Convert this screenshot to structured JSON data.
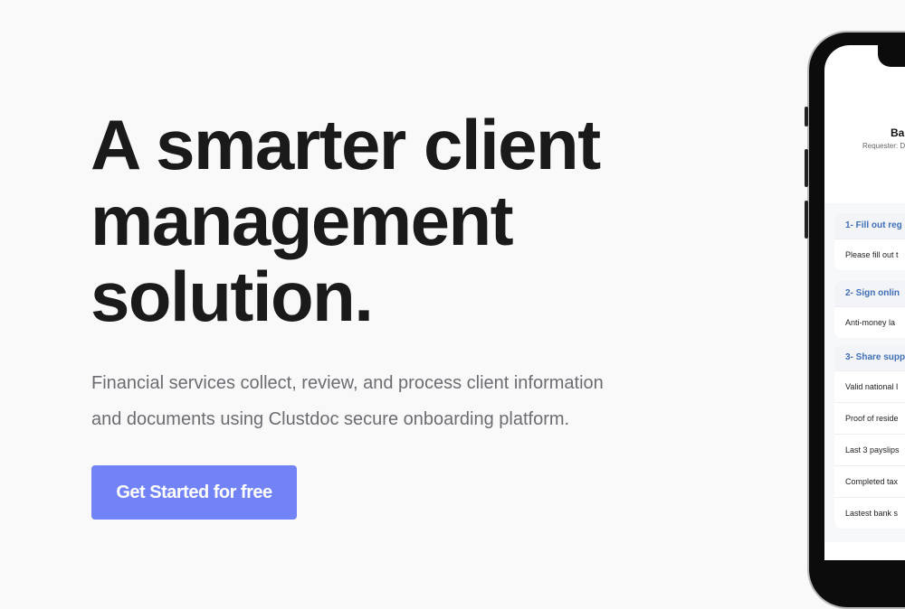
{
  "hero": {
    "title": "A smarter client management solution.",
    "subtitle": "Financial services collect, review, and process client information and documents using Clustdoc secure onboarding platform.",
    "cta_label": "Get Started for free"
  },
  "phone": {
    "title": "Ba",
    "requester": "Requester: D",
    "sections": [
      {
        "heading": "1- Fill out reg",
        "items": [
          "Please fill out t"
        ]
      },
      {
        "heading": "2- Sign onlin",
        "items": [
          "Anti-money la"
        ]
      },
      {
        "heading": "3- Share supp",
        "items": [
          "Valid national I",
          "Proof of reside",
          "Last 3 payslips",
          "Completed tax",
          "Lastest bank s"
        ]
      }
    ]
  },
  "colors": {
    "accent": "#7283f8",
    "section_heading": "#3f6fb6"
  }
}
